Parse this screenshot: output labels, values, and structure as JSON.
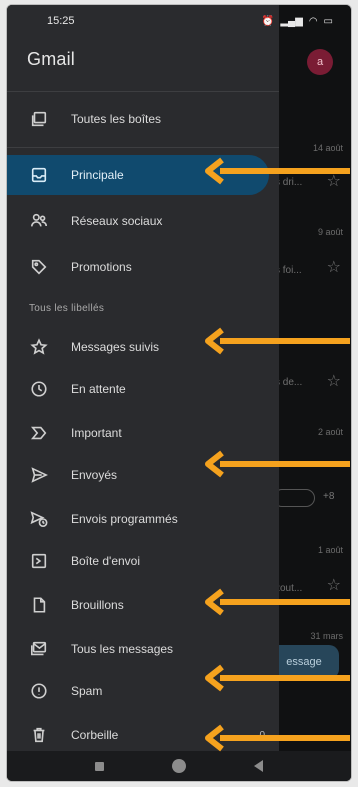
{
  "status_bar": {
    "time": "15:25",
    "icons": [
      "alarm-icon",
      "signal-icon",
      "wifi-icon",
      "battery-icon"
    ]
  },
  "app": {
    "title": "Gmail",
    "avatar_letter": "a",
    "accent_color": "#104a6e",
    "arrow_color": "#f5a21e"
  },
  "drawer": {
    "top_item": {
      "label": "Toutes les boîtes",
      "icon": "all-inboxes-icon"
    },
    "primary_items": [
      {
        "label": "Principale",
        "icon": "inbox-icon",
        "active": true
      },
      {
        "label": "Réseaux sociaux",
        "icon": "people-icon",
        "active": false
      },
      {
        "label": "Promotions",
        "icon": "tag-icon",
        "active": false
      }
    ],
    "section_label": "Tous les libellés",
    "label_items": [
      {
        "label": "Messages suivis",
        "icon": "star-icon"
      },
      {
        "label": "En attente",
        "icon": "clock-icon"
      },
      {
        "label": "Important",
        "icon": "important-icon"
      },
      {
        "label": "Envoyés",
        "icon": "send-icon"
      },
      {
        "label": "Envois programmés",
        "icon": "scheduled-send-icon"
      },
      {
        "label": "Boîte d'envoi",
        "icon": "outbox-icon"
      },
      {
        "label": "Brouillons",
        "icon": "draft-icon"
      },
      {
        "label": "Tous les messages",
        "icon": "all-mail-icon"
      },
      {
        "label": "Spam",
        "icon": "spam-icon"
      },
      {
        "label": "Corbeille",
        "icon": "trash-icon",
        "count": "0"
      }
    ]
  },
  "background_list": {
    "dates": [
      "14 août",
      "9 août",
      "2 août",
      "1 août",
      "31 mars"
    ],
    "snippets": [
      "s dri...",
      "s foi...",
      "s de...",
      "zout...",
      "essage"
    ],
    "chip_plus": "+8"
  },
  "nav_bar": {
    "buttons": [
      "recents-button",
      "home-button",
      "back-button"
    ]
  }
}
